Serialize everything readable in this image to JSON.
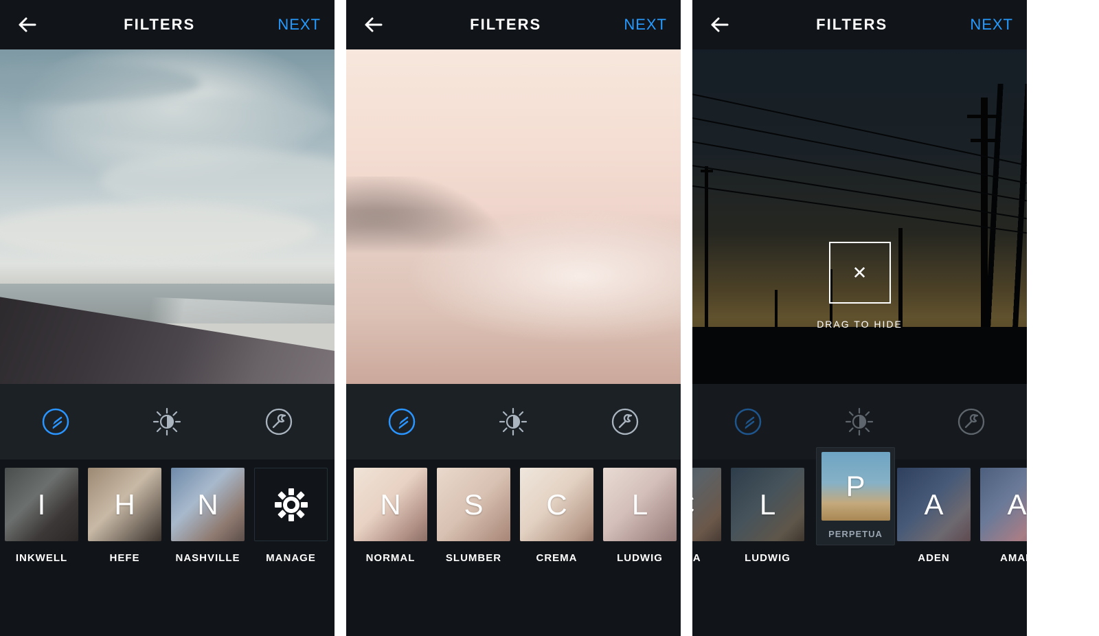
{
  "header": {
    "title": "FILTERS",
    "next_label": "NEXT"
  },
  "drag_overlay": {
    "hint": "DRAG TO HIDE",
    "close_glyph": "✕"
  },
  "floating_filter": {
    "letter": "P",
    "label": "PERPETUA"
  },
  "screens": [
    {
      "filters": [
        {
          "letter": "I",
          "label": "INKWELL",
          "class": "g-inkwell"
        },
        {
          "letter": "H",
          "label": "HEFE",
          "class": "g-hefe"
        },
        {
          "letter": "N",
          "label": "NASHVILLE",
          "class": "g-nash"
        }
      ],
      "manage_label": "MANAGE"
    },
    {
      "filters": [
        {
          "letter": "N",
          "label": "NORMAL",
          "class": "g-normal"
        },
        {
          "letter": "S",
          "label": "SLUMBER",
          "class": "g-slumber"
        },
        {
          "letter": "C",
          "label": "CREMA",
          "class": "g-crema"
        },
        {
          "letter": "L",
          "label": "LUDWIG",
          "class": "g-ludwig"
        }
      ]
    },
    {
      "filters": [
        {
          "letter": "C",
          "label": "REMA",
          "class": "g-dcrema",
          "offset": -72
        },
        {
          "letter": "L",
          "label": "LUDWIG",
          "class": "g-dludwig"
        },
        {
          "letter": "",
          "label": "",
          "class": "",
          "spacer": true
        },
        {
          "letter": "A",
          "label": "ADEN",
          "class": "g-aden"
        },
        {
          "letter": "A",
          "label": "AMAR",
          "class": "g-amaro"
        }
      ]
    }
  ]
}
